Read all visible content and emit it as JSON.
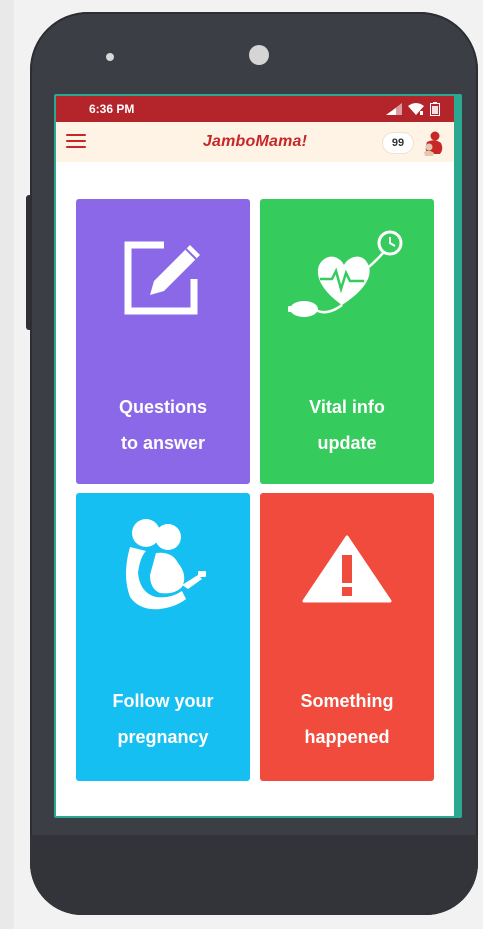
{
  "status_bar": {
    "time": "6:36 PM"
  },
  "app_bar": {
    "title": "JamboMama!",
    "badge_count": "99",
    "accent_color": "#c62828",
    "background_color": "#fff3e6"
  },
  "tiles": [
    {
      "line1": "Questions",
      "line2": "to answer",
      "color": "#8a68e8",
      "icon": "edit-icon"
    },
    {
      "line1": "Vital info",
      "line2": "update",
      "color": "#35cb5d",
      "icon": "blood-pressure-heart-icon"
    },
    {
      "line1": "Follow your",
      "line2": "pregnancy",
      "color": "#16bff2",
      "icon": "pregnancy-couple-icon"
    },
    {
      "line1": "Something",
      "line2": "happened",
      "color": "#f04b3c",
      "icon": "warning-icon"
    }
  ]
}
